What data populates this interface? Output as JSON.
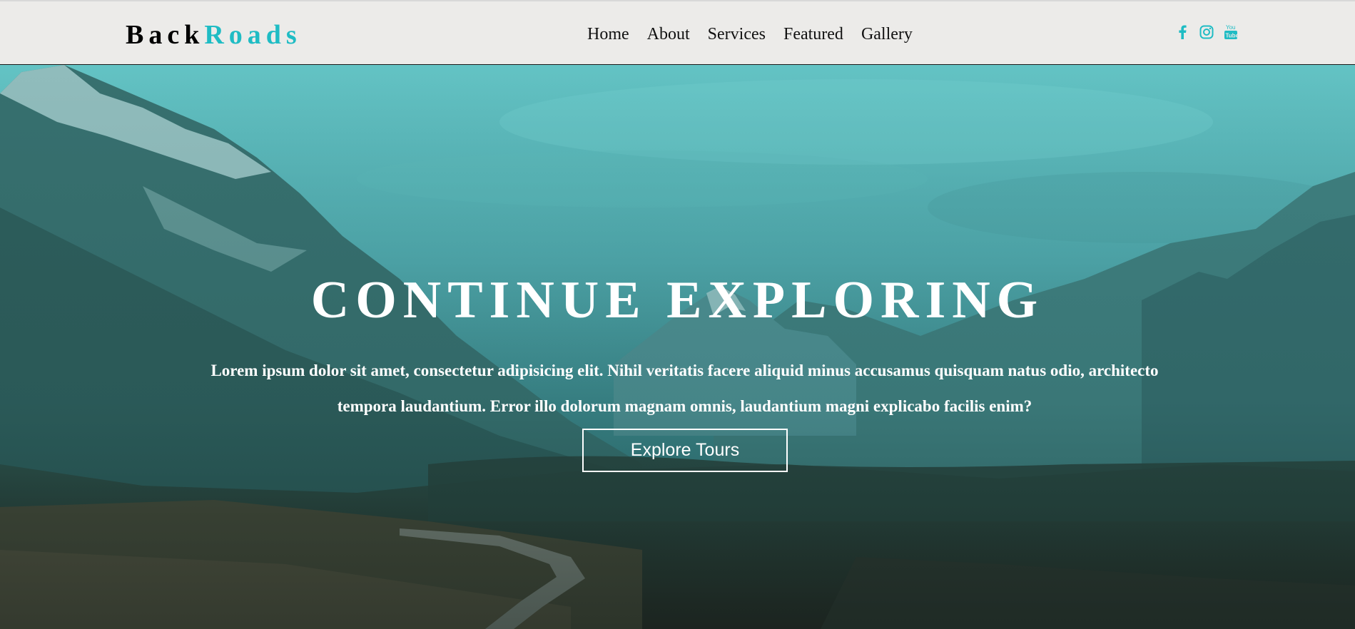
{
  "brand": {
    "name_part1": "Back",
    "name_part2": "Roads",
    "accent_color": "#1fbcc4"
  },
  "nav": {
    "links": [
      {
        "label": "Home"
      },
      {
        "label": "About"
      },
      {
        "label": "Services"
      },
      {
        "label": "Featured"
      },
      {
        "label": "Gallery"
      }
    ]
  },
  "social": {
    "icons": [
      "facebook-icon",
      "instagram-icon",
      "youtube-icon"
    ],
    "color": "#1fbcc4"
  },
  "hero": {
    "title": "CONTINUE EXPLORING",
    "text": "Lorem ipsum dolor sit amet, consectetur adipisicing elit. Nihil veritatis facere aliquid minus accusamus quisquam natus odio, architecto tempora laudantium. Error illo dolorum magnam omnis, laudantium magni explicabo facilis enim?",
    "button_label": "Explore Tours",
    "overlay_color": "#2aa7a9"
  }
}
